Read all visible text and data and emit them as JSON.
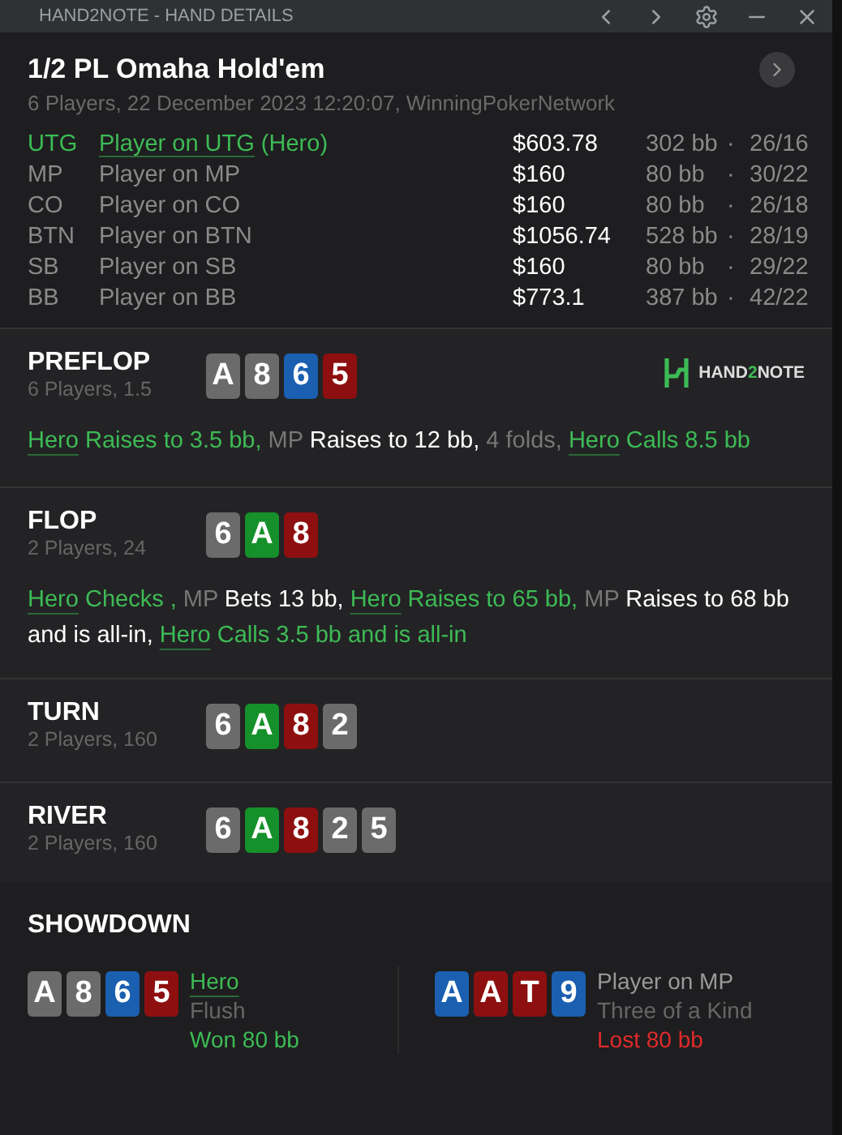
{
  "window": {
    "title": "HAND2NOTE - HAND DETAILS"
  },
  "hand": {
    "title": "1/2 PL Omaha Hold'em",
    "subtitle": "6 Players, 22 December 2023 12:20:07, WinningPokerNetwork"
  },
  "players": [
    {
      "position": "UTG",
      "name": "Player on UTG",
      "suffix": "(Hero)",
      "hero": true,
      "stack": "$603.78",
      "bb": "302 bb",
      "sep": "·",
      "stats": "26/16"
    },
    {
      "position": "MP",
      "name": "Player on MP",
      "hero": false,
      "stack": "$160",
      "bb": "80 bb",
      "sep": "·",
      "stats": "30/22"
    },
    {
      "position": "CO",
      "name": "Player on CO",
      "hero": false,
      "stack": "$160",
      "bb": "80 bb",
      "sep": "·",
      "stats": "26/18"
    },
    {
      "position": "BTN",
      "name": "Player on BTN",
      "hero": false,
      "stack": "$1056.74",
      "bb": "528 bb",
      "sep": "·",
      "stats": "28/19"
    },
    {
      "position": "SB",
      "name": "Player on SB",
      "hero": false,
      "stack": "$160",
      "bb": "80 bb",
      "sep": "·",
      "stats": "29/22"
    },
    {
      "position": "BB",
      "name": "Player on BB",
      "hero": false,
      "stack": "$773.1",
      "bb": "387 bb",
      "sep": "·",
      "stats": "42/22"
    }
  ],
  "logo": {
    "text_a": "HAND",
    "text_b": "2",
    "text_c": "NOTE"
  },
  "streets": [
    {
      "name": "PREFLOP",
      "info": "6 Players, 1.5",
      "logo": true,
      "cards": [
        {
          "rank": "A",
          "color": "#6b6b6b"
        },
        {
          "rank": "8",
          "color": "#6b6b6b"
        },
        {
          "rank": "6",
          "color": "#1a5fb0"
        },
        {
          "rank": "5",
          "color": "#8e0f0f"
        }
      ],
      "actions": [
        {
          "kind": "hero",
          "text": "Hero"
        },
        {
          "kind": "hero-action",
          "text": " Raises to 3.5 bb,"
        },
        {
          "kind": "actor",
          "text": " MP"
        },
        {
          "kind": "action",
          "text": " Raises to 12 bb,"
        },
        {
          "kind": "muted",
          "text": " 4 folds, "
        },
        {
          "kind": "hero",
          "text": "Hero"
        },
        {
          "kind": "hero-action",
          "text": " Calls 8.5 bb"
        }
      ]
    },
    {
      "name": "FLOP",
      "info": "2 Players, 24",
      "logo": false,
      "cards": [
        {
          "rank": "6",
          "color": "#6b6b6b"
        },
        {
          "rank": "A",
          "color": "#15902a"
        },
        {
          "rank": "8",
          "color": "#8e0f0f"
        }
      ],
      "actions": [
        {
          "kind": "hero",
          "text": "Hero"
        },
        {
          "kind": "hero-action",
          "text": " Checks ,"
        },
        {
          "kind": "actor",
          "text": " MP"
        },
        {
          "kind": "action",
          "text": " Bets 13 bb, "
        },
        {
          "kind": "hero",
          "text": "Hero"
        },
        {
          "kind": "hero-action",
          "text": " Raises to 65 bb,"
        },
        {
          "kind": "actor",
          "text": " MP"
        },
        {
          "kind": "action",
          "text": " Raises to 68 bb and is all-in, "
        },
        {
          "kind": "hero",
          "text": "Hero"
        },
        {
          "kind": "hero-action",
          "text": " Calls 3.5 bb and is all-in"
        }
      ]
    },
    {
      "name": "TURN",
      "info": "2 Players, 160",
      "logo": false,
      "cards": [
        {
          "rank": "6",
          "color": "#6b6b6b"
        },
        {
          "rank": "A",
          "color": "#15902a"
        },
        {
          "rank": "8",
          "color": "#8e0f0f"
        },
        {
          "rank": "2",
          "color": "#6b6b6b"
        }
      ]
    },
    {
      "name": "RIVER",
      "info": "2 Players, 160",
      "logo": false,
      "cards": [
        {
          "rank": "6",
          "color": "#6b6b6b"
        },
        {
          "rank": "A",
          "color": "#15902a"
        },
        {
          "rank": "8",
          "color": "#8e0f0f"
        },
        {
          "rank": "2",
          "color": "#6b6b6b"
        },
        {
          "rank": "5",
          "color": "#6b6b6b"
        }
      ]
    }
  ],
  "showdown": {
    "title": "SHOWDOWN",
    "hands": [
      {
        "player": "Hero",
        "hero": true,
        "hand": "Flush",
        "result": "Won 80 bb",
        "won": true,
        "cards": [
          {
            "rank": "A",
            "color": "#6b6b6b"
          },
          {
            "rank": "8",
            "color": "#6b6b6b"
          },
          {
            "rank": "6",
            "color": "#1a5fb0"
          },
          {
            "rank": "5",
            "color": "#8e0f0f"
          }
        ]
      },
      {
        "player": "Player on MP",
        "hero": false,
        "hand": "Three of a Kind",
        "result": "Lost 80 bb",
        "won": false,
        "cards": [
          {
            "rank": "A",
            "color": "#1a5fb0"
          },
          {
            "rank": "A",
            "color": "#8e0f0f"
          },
          {
            "rank": "T",
            "color": "#8e0f0f"
          },
          {
            "rank": "9",
            "color": "#1a5fb0"
          }
        ]
      }
    ]
  }
}
